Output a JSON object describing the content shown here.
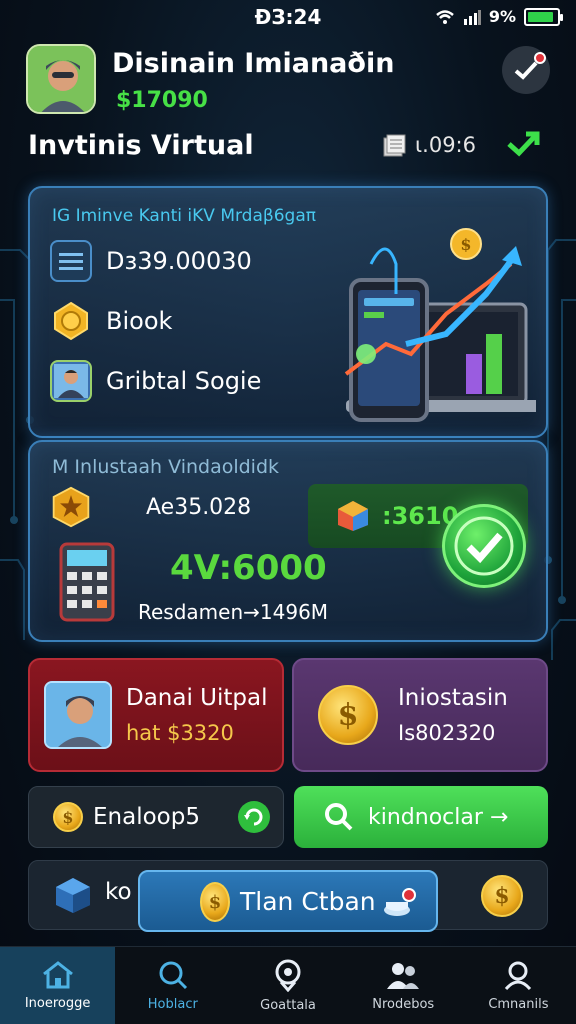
{
  "status": {
    "time": "ĐЗ:24",
    "battery_text": "9%",
    "battery_level": 0.9
  },
  "header": {
    "title": "Disinain Imianaðin",
    "balance": "$17090",
    "subtitle": "Invtinis Virtual",
    "stat": "ɩ.09:6"
  },
  "card1": {
    "heading": "IG Iminve Kanti iKV Mrdaβ6gaπ",
    "row1": "Dз39.00030",
    "row2": "Biook",
    "row3": "Gribtal Sogie"
  },
  "card2": {
    "heading": "M Inlustaah Vindaoldidk",
    "value1": "Ae35.028",
    "pill": ":3610",
    "big_value": "4V:6000",
    "line": "Resdamen→1496M"
  },
  "tiles": {
    "left": {
      "title": "Danai Uitpal",
      "value": "hat $3320"
    },
    "right": {
      "title": "Iniostasin",
      "value": "Is802320"
    }
  },
  "bars": {
    "left_label": "Enaloop5",
    "right_label": "kindnoclar →",
    "bottom_label": "ko"
  },
  "popup": {
    "label": "Tlan Ctban"
  },
  "nav": [
    {
      "label": "Inoerogge",
      "icon": "home-icon"
    },
    {
      "label": "Hoblacr",
      "icon": "search-icon"
    },
    {
      "label": "Goattala",
      "icon": "location-icon"
    },
    {
      "label": "Nrodebos",
      "icon": "people-icon"
    },
    {
      "label": "Cmnanils",
      "icon": "profile-icon"
    }
  ],
  "colors": {
    "accent_green": "#47e046",
    "accent_blue": "#49c9ef",
    "card_border": "#3a7fb8"
  }
}
